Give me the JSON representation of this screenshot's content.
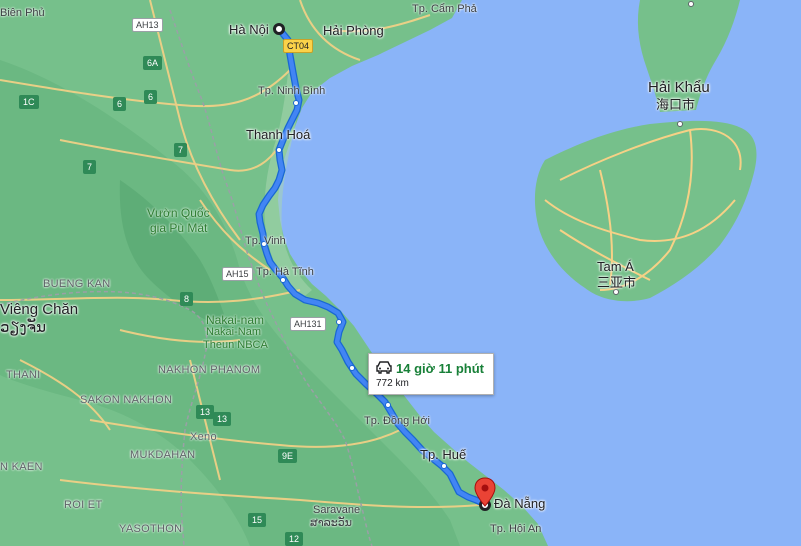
{
  "route": {
    "origin": "Hà Nội",
    "destination": "Đà Nẵng",
    "duration": "14 giờ 11 phút",
    "distance": "772 km"
  },
  "cities": {
    "hanoi": "Hà Nội",
    "haiphong": "Hải Phòng",
    "camcha": "Tp. Cẩm Phả",
    "ninhbinh": "Tp. Ninh Bình",
    "thanhhoa": "Thanh Hoá",
    "vinh": "Tp. Vinh",
    "hatinh": "Tp. Hà Tĩnh",
    "donghoi": "Tp. Đồng Hới",
    "hue": "Tp. Huế",
    "danang": "Đà Nẵng",
    "hoian": "Tp. Hội An",
    "haikhau": "Hải Khẩu",
    "haikhau_cn": "海口市",
    "tama": "Tam Á",
    "tama_cn": "三亚市",
    "vientiane": "Viêng Chăn",
    "vientiane_lo": "ວຽງຈັນ",
    "bienphu": "Biên Phủ",
    "saravane": "Saravane",
    "saravane_lo": "ສາລະວັນ"
  },
  "regions": {
    "bueng_kan": "BUENG KAN",
    "thani": "THANI",
    "nakhon_phanom": "NAKHON PHANOM",
    "sakon_nakhon": "SAKON NAKHON",
    "mukdahan": "MUKDAHAN",
    "xeno": "Xeno",
    "kaen": "N KAEN",
    "roi_et": "ROI ET",
    "yasothon": "YASOTHON"
  },
  "parks": {
    "pumat_1": "Vườn Quốc",
    "pumat_2": "gia Pù Mát",
    "nakai_1": "Nakai-nam",
    "nakai_2": "Nakai-Nam",
    "nakai_3": "Theun NBCA"
  },
  "shields": {
    "ah13": "AH13",
    "ct04": "CT04",
    "ah15": "AH15",
    "ah131": "AH131",
    "r6a": "6A",
    "r1c": "1C",
    "r6": "6",
    "r6b": "6",
    "r7": "7",
    "r7b": "7",
    "r8": "8",
    "r13": "13",
    "r13b": "13",
    "r9e": "9E",
    "r15": "15",
    "r12": "12"
  },
  "colors": {
    "water": "#8ab4f8",
    "land": "#74c28a",
    "route": "#4285f4",
    "road": "#f6d186"
  }
}
